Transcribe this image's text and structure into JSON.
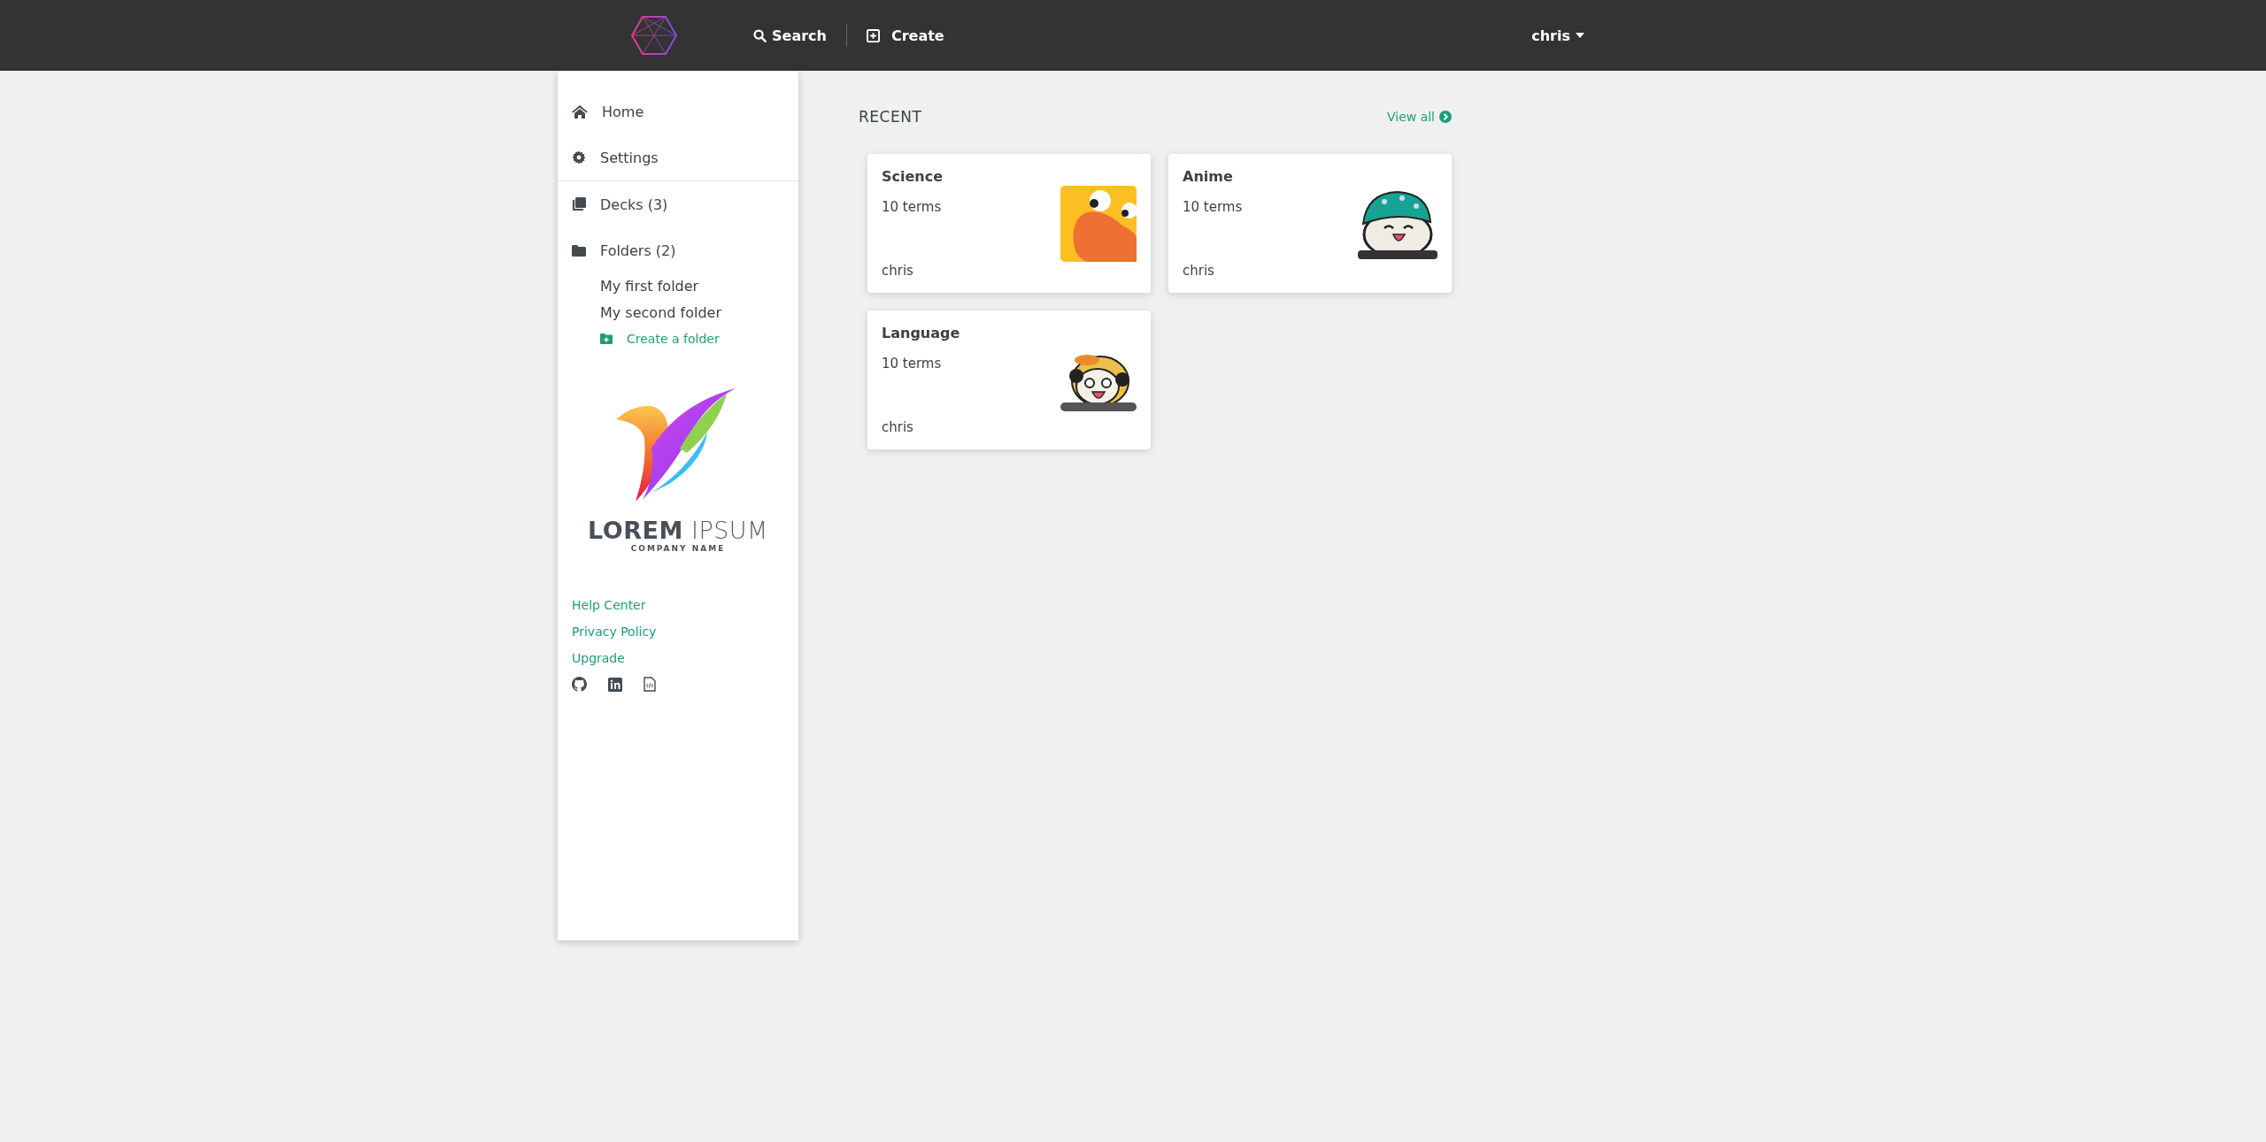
{
  "header": {
    "search": "Search",
    "create": "Create",
    "user": "chris"
  },
  "sidebar": {
    "nav": [
      {
        "kind": "home",
        "label": "Home"
      },
      {
        "kind": "settings",
        "label": "Settings"
      }
    ],
    "sections": [
      {
        "kind": "decks",
        "label": "Decks (3)"
      },
      {
        "kind": "folders",
        "label": "Folders (2)",
        "children": [
          {
            "label": "My first folder"
          },
          {
            "label": "My second folder"
          }
        ]
      }
    ],
    "create_folder": "Create a folder",
    "ad": {
      "brand_bold": "LOREM",
      "brand_light": "IPSUM",
      "tagline": "COMPANY NAME"
    },
    "links": [
      "Help Center",
      "Privacy Policy",
      "Upgrade"
    ],
    "socials": [
      {
        "kind": "github"
      },
      {
        "kind": "linkedin"
      },
      {
        "kind": "code-file"
      }
    ]
  },
  "recent": {
    "title": "RECENT",
    "view_all": "View all",
    "cards": [
      {
        "kind": "duck",
        "title": "Science",
        "terms": "10 terms",
        "author": "chris"
      },
      {
        "kind": "beanie",
        "title": "Anime",
        "terms": "10 terms",
        "author": "chris"
      },
      {
        "kind": "panda",
        "title": "Language",
        "terms": "10 terms",
        "author": "chris"
      }
    ]
  }
}
